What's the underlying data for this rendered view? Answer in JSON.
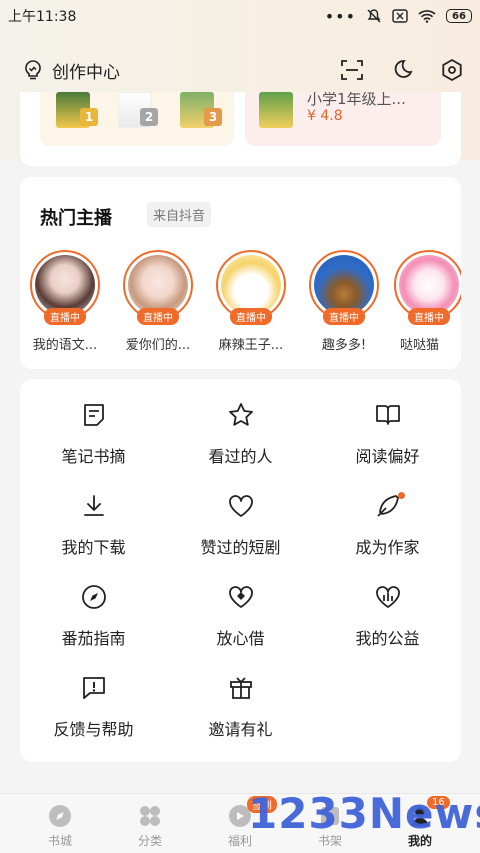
{
  "status_bar": {
    "time": "上午11:38",
    "battery": "66"
  },
  "header": {
    "creator_label": "创作中心",
    "icons": [
      "scan-icon",
      "moon-icon",
      "settings-icon"
    ]
  },
  "books": {
    "left_ranks": [
      "1",
      "2",
      "3"
    ],
    "right_title": "小学1年级上...",
    "right_rating": "¥ 4.8"
  },
  "streamers_section": {
    "title": "热门主播",
    "source": "来自抖音",
    "live_label": "直播中",
    "items": [
      {
        "name": "我的语文..."
      },
      {
        "name": "爱你们的..."
      },
      {
        "name": "麻辣王子..."
      },
      {
        "name": "趣多多!"
      },
      {
        "name": "哒哒猫"
      }
    ]
  },
  "features": {
    "items": [
      {
        "label": "笔记书摘",
        "icon": "note-icon"
      },
      {
        "label": "看过的人",
        "icon": "star-icon"
      },
      {
        "label": "阅读偏好",
        "icon": "book-icon"
      },
      {
        "label": "我的下载",
        "icon": "download-icon"
      },
      {
        "label": "赞过的短剧",
        "icon": "heart-icon"
      },
      {
        "label": "成为作家",
        "icon": "quill-icon"
      },
      {
        "label": "番茄指南",
        "icon": "compass-icon"
      },
      {
        "label": "放心借",
        "icon": "shield-heart-icon"
      },
      {
        "label": "我的公益",
        "icon": "charity-heart-icon"
      },
      {
        "label": "反馈与帮助",
        "icon": "feedback-icon"
      },
      {
        "label": "邀请有礼",
        "icon": "gift-icon"
      }
    ]
  },
  "bottom_nav": {
    "items": [
      {
        "label": "书城"
      },
      {
        "label": "分类"
      },
      {
        "label": "福利",
        "badge": "签到"
      },
      {
        "label": "书架"
      },
      {
        "label": "我的",
        "badge": "16"
      }
    ]
  },
  "watermark": "1233News",
  "colors": {
    "accent": "#f06a2a",
    "watermark": "#3f64d8"
  }
}
